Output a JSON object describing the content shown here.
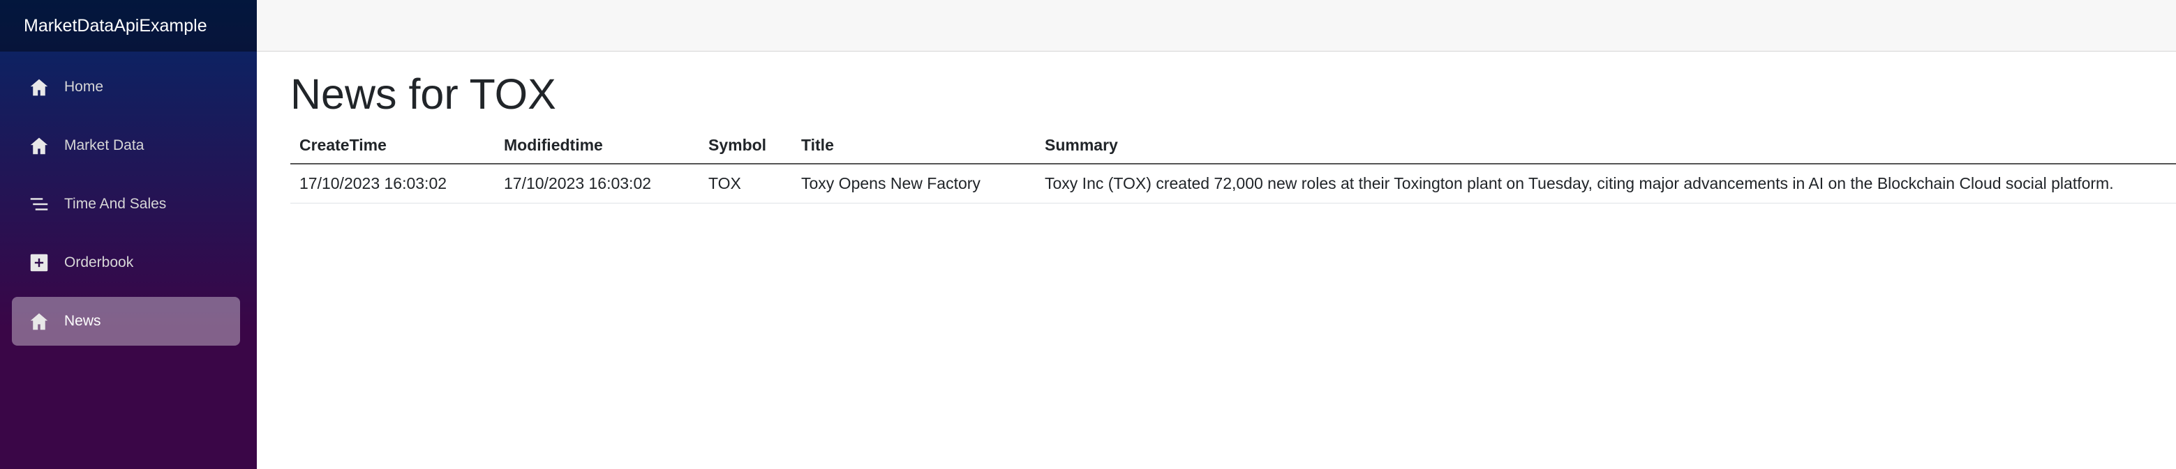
{
  "app": {
    "brand": "MarketDataApiExample"
  },
  "sidebar": {
    "items": [
      {
        "label": "Home",
        "icon": "home-icon",
        "active": false
      },
      {
        "label": "Market Data",
        "icon": "home-icon",
        "active": false
      },
      {
        "label": "Time And Sales",
        "icon": "list-icon",
        "active": false
      },
      {
        "label": "Orderbook",
        "icon": "plus-icon",
        "active": false
      },
      {
        "label": "News",
        "icon": "home-icon",
        "active": true
      }
    ]
  },
  "main": {
    "title": "News for TOX",
    "table": {
      "headers": [
        "CreateTime",
        "Modifiedtime",
        "Symbol",
        "Title",
        "Summary"
      ],
      "rows": [
        [
          "17/10/2023 16:03:02",
          "17/10/2023 16:03:02",
          "TOX",
          "Toxy Opens New Factory",
          "Toxy Inc (TOX) created 72,000 new roles at their Toxington plant on Tuesday, citing major advancements in AI on the Blockchain Cloud social platform."
        ]
      ]
    }
  },
  "colors": {
    "sidebar_top": "#052767",
    "sidebar_bottom": "#3a0647",
    "active_item_bg": "rgba(255,255,255,0.37)",
    "topbar_bg": "#f7f7f7"
  }
}
